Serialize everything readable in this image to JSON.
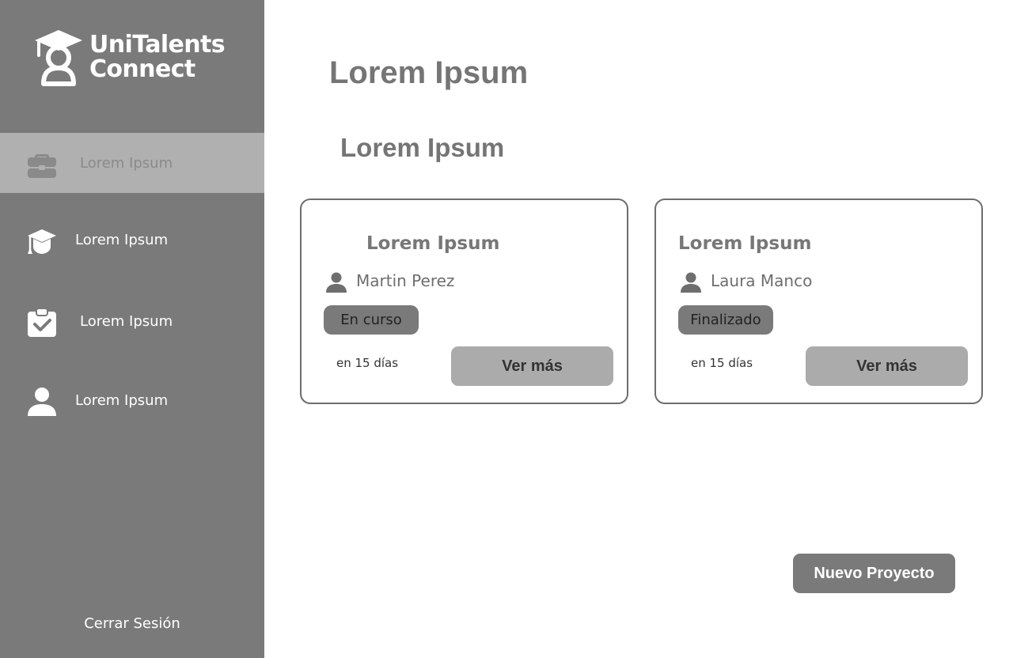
{
  "app": {
    "logo_line1": "UniTalents",
    "logo_line2": "Connect"
  },
  "sidebar": {
    "items": [
      {
        "label": "Lorem Ipsum",
        "icon": "briefcase-icon",
        "active": true
      },
      {
        "label": "Lorem Ipsum",
        "icon": "graduation-cap-icon",
        "active": false
      },
      {
        "label": "Lorem Ipsum",
        "icon": "clipboard-check-icon",
        "active": false
      },
      {
        "label": "Lorem Ipsum",
        "icon": "user-icon",
        "active": false
      }
    ],
    "logout_label": "Cerrar Sesión"
  },
  "main": {
    "title": "Lorem Ipsum",
    "section_title": "Lorem Ipsum",
    "cards": [
      {
        "title": "Lorem Ipsum",
        "person": "Martin Perez",
        "status": "En curso",
        "due": "en 15 días",
        "button_label": "Ver más"
      },
      {
        "title": "Lorem Ipsum",
        "person": "Laura Manco",
        "status": "Finalizado",
        "due": "en 15 días",
        "button_label": "Ver más"
      }
    ],
    "new_project_label": "Nuevo Proyecto"
  },
  "colors": {
    "sidebar_bg": "#7a7a7a",
    "sidebar_active_bg": "#b0b0b0",
    "text_gray": "#757575",
    "button_light": "#ababab",
    "button_dark": "#7a7a7a"
  }
}
